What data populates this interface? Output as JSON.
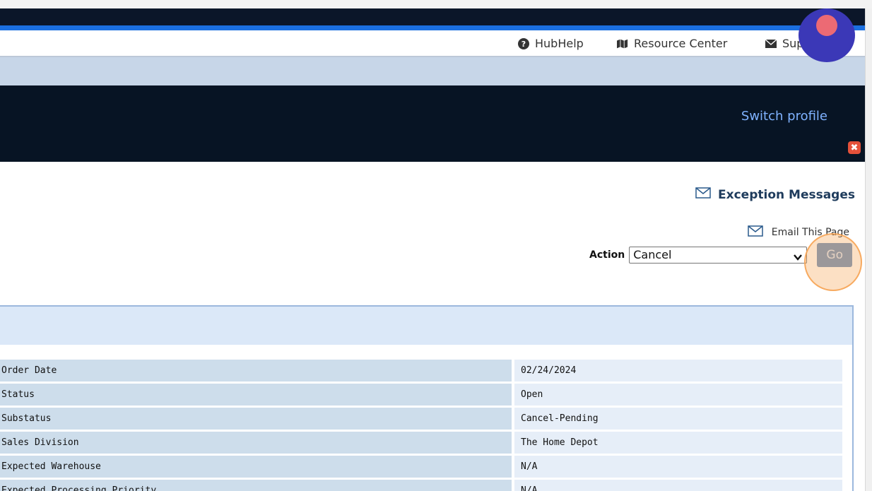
{
  "header": {
    "links": [
      {
        "label": "HubHelp",
        "icon": "question-circle-icon"
      },
      {
        "label": "Resource Center",
        "icon": "map-icon"
      },
      {
        "label": "Support",
        "icon": "envelope-icon"
      }
    ],
    "switch_profile": "Switch profile"
  },
  "messages": {
    "exception_label": "Exception Messages",
    "email_page_label": "Email This Page"
  },
  "action": {
    "label": "Action",
    "selected": "Cancel",
    "go_label": "Go"
  },
  "details": {
    "rows": [
      {
        "label": "Order Date",
        "value": "02/24/2024"
      },
      {
        "label": "Status",
        "value": "Open"
      },
      {
        "label": "Substatus",
        "value": "Cancel-Pending"
      },
      {
        "label": "Sales Division",
        "value": "The Home Depot"
      },
      {
        "label": "Expected Warehouse",
        "value": "N/A"
      },
      {
        "label": "Expected Processing Priority",
        "value": "N/A"
      }
    ]
  },
  "colors": {
    "navy": "#071424",
    "accent_blue": "#1b6fe0",
    "go_button": "#6b91bf",
    "highlight": "#f7a555",
    "recording_badge": "#3b38b7"
  }
}
